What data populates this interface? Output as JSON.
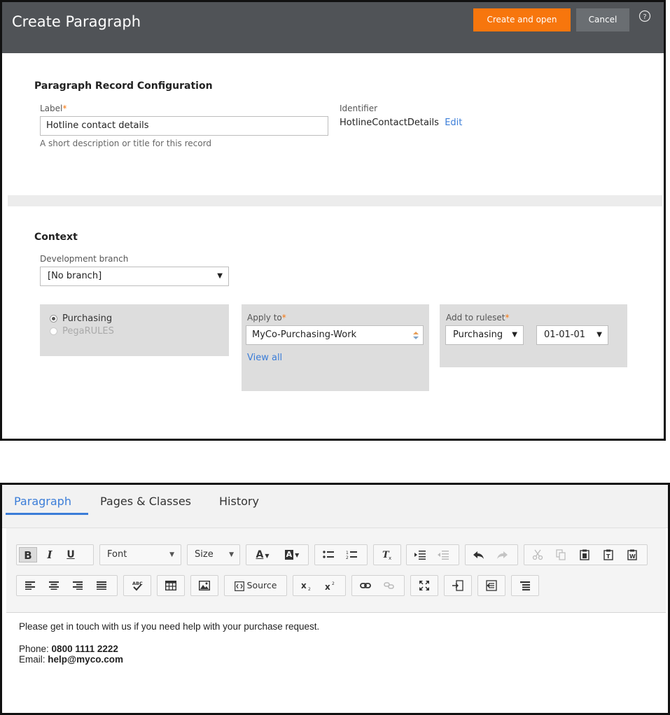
{
  "dialog": {
    "title": "Create Paragraph",
    "create_label": "Create and open",
    "cancel_label": "Cancel",
    "help_icon": "help-circle-icon",
    "colors": {
      "header_bg": "#505357",
      "create_btn": "#f7760d",
      "cancel_btn": "#6a6e72",
      "link": "#3b7dd8",
      "required": "#f7760d"
    }
  },
  "record_config": {
    "heading": "Paragraph Record Configuration",
    "label_field": {
      "label": "Label",
      "required_mark": "*",
      "value": "Hotline contact details",
      "hint": "A short description or title for this record"
    },
    "identifier": {
      "label": "Identifier",
      "value": "HotlineContactDetails",
      "edit_link": "Edit"
    }
  },
  "context": {
    "heading": "Context",
    "branch": {
      "label": "Development branch",
      "value": "[No branch]"
    },
    "layer_options": [
      {
        "label": "Purchasing",
        "selected": true
      },
      {
        "label": "PegaRULES",
        "selected": false
      }
    ],
    "apply_to": {
      "label": "Apply to",
      "required_mark": "*",
      "value": "MyCo-Purchasing-Work",
      "view_all": "View all"
    },
    "ruleset": {
      "label": "Add to ruleset",
      "required_mark": "*",
      "name": "Purchasing",
      "version": "01-01-01"
    }
  },
  "tabs": [
    {
      "label": "Paragraph",
      "active": true
    },
    {
      "label": "Pages & Classes",
      "active": false
    },
    {
      "label": "History",
      "active": false
    }
  ],
  "toolbar": {
    "bold": "B",
    "italic": "I",
    "underline": "U",
    "font_label": "Font",
    "size_label": "Size",
    "text_color_label": "A",
    "bg_color_label": "A",
    "source_label": "Source",
    "icons": [
      "bold-icon",
      "italic-icon",
      "underline-icon",
      "bulleted-list-icon",
      "numbered-list-icon",
      "remove-format-icon",
      "indent-icon",
      "outdent-icon",
      "undo-icon",
      "redo-icon",
      "cut-icon",
      "copy-icon",
      "paste-icon",
      "paste-text-icon",
      "paste-word-icon",
      "align-left-icon",
      "align-center-icon",
      "align-right-icon",
      "justify-icon",
      "spellcheck-icon",
      "table-icon",
      "image-icon",
      "source-icon",
      "subscript-icon",
      "superscript-icon",
      "link-icon",
      "unlink-icon",
      "maximize-icon",
      "insert-field-icon",
      "insert-section-icon",
      "insert-paragraph-icon"
    ]
  },
  "editor": {
    "line1": "Please get in touch with us if you need help with your purchase request.",
    "phone_label": "Phone: ",
    "phone_value": "0800 1111 2222",
    "email_label": "Email: ",
    "email_value": "help@myco.com"
  }
}
